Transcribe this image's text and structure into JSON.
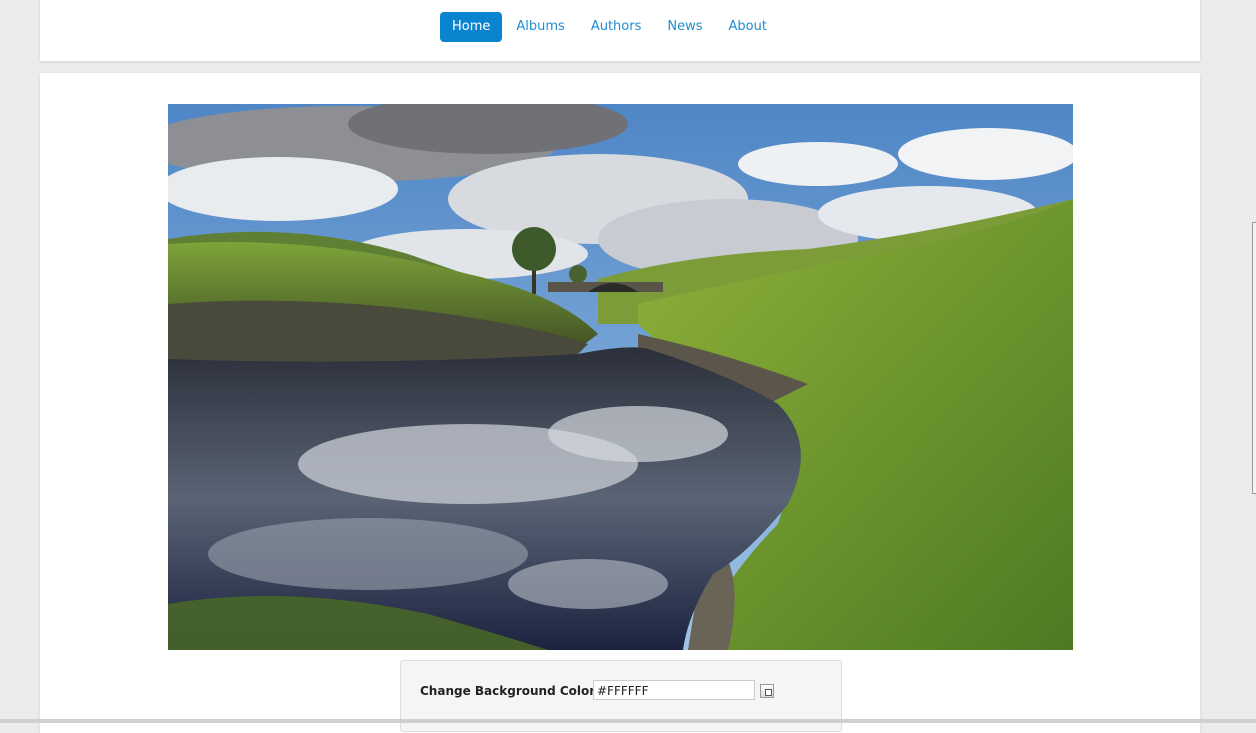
{
  "nav": {
    "items": [
      {
        "label": "Home",
        "active": true
      },
      {
        "label": "Albums",
        "active": false
      },
      {
        "label": "Authors",
        "active": false
      },
      {
        "label": "News",
        "active": false
      },
      {
        "label": "About",
        "active": false
      }
    ]
  },
  "color_panel": {
    "label": "Change Background Color",
    "value": "#FFFFFF"
  },
  "colors": {
    "accent": "#0b84d0",
    "link": "#1f8dcf",
    "page_background": "#ececec"
  },
  "icons": {
    "picker": "color-picker-icon"
  }
}
